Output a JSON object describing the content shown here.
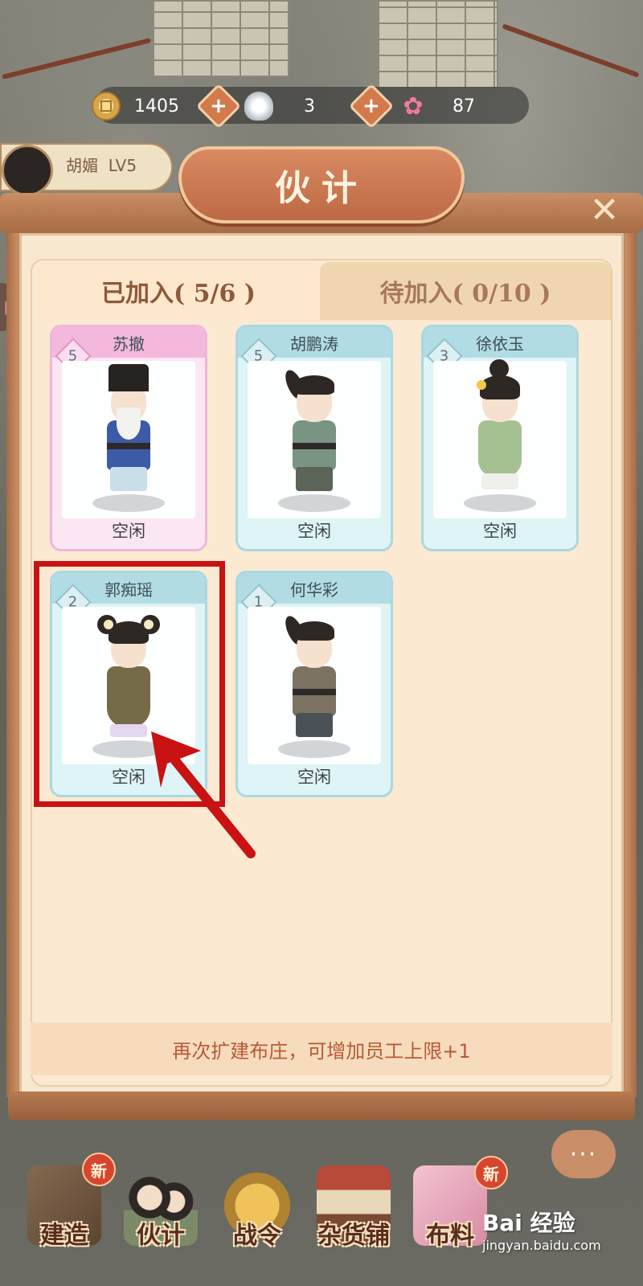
{
  "resources": {
    "coins": "1405",
    "silver": "3",
    "flowers": "87",
    "coin_icon": "coin-icon",
    "silver_icon": "silver-ingot-icon",
    "flower_icon": "flower-icon",
    "plus_label": "+"
  },
  "player": {
    "name": "胡媚",
    "level": "LV5"
  },
  "dialog": {
    "title": "伙计",
    "close_label": "✕",
    "tabs": [
      {
        "label": "已加入( 5/6 )",
        "active": true
      },
      {
        "label": "待加入( 0/10 )",
        "active": false
      }
    ],
    "workers": [
      {
        "name": "苏撤",
        "level": "5",
        "status": "空闲",
        "rarity": "pink"
      },
      {
        "name": "胡鹏涛",
        "level": "5",
        "status": "空闲",
        "rarity": "blue"
      },
      {
        "name": "徐依玉",
        "level": "3",
        "status": "空闲",
        "rarity": "blue"
      },
      {
        "name": "郭痴瑶",
        "level": "2",
        "status": "空闲",
        "rarity": "blue"
      },
      {
        "name": "何华彩",
        "level": "1",
        "status": "空闲",
        "rarity": "blue"
      }
    ],
    "footer_note": "再次扩建布庄，可增加员工上限+1"
  },
  "nav": {
    "items": [
      {
        "label": "建造",
        "badge": "新"
      },
      {
        "label": "伙计",
        "badge": ""
      },
      {
        "label": "战令",
        "badge": ""
      },
      {
        "label": "杂货铺",
        "badge": ""
      },
      {
        "label": "布料",
        "badge": "新"
      }
    ],
    "chat_label": "···"
  },
  "watermark": {
    "text": "Bai 经验",
    "url": "jingyan.baidu.com"
  },
  "annotation": {
    "highlight_color": "#c91212"
  },
  "colors": {
    "panel_bg": "#fce9d2",
    "title_plaque": "#bd6a44",
    "card_blue": "#b1dce3",
    "card_pink": "#f4b8dc",
    "footer_text": "#b85a37"
  }
}
